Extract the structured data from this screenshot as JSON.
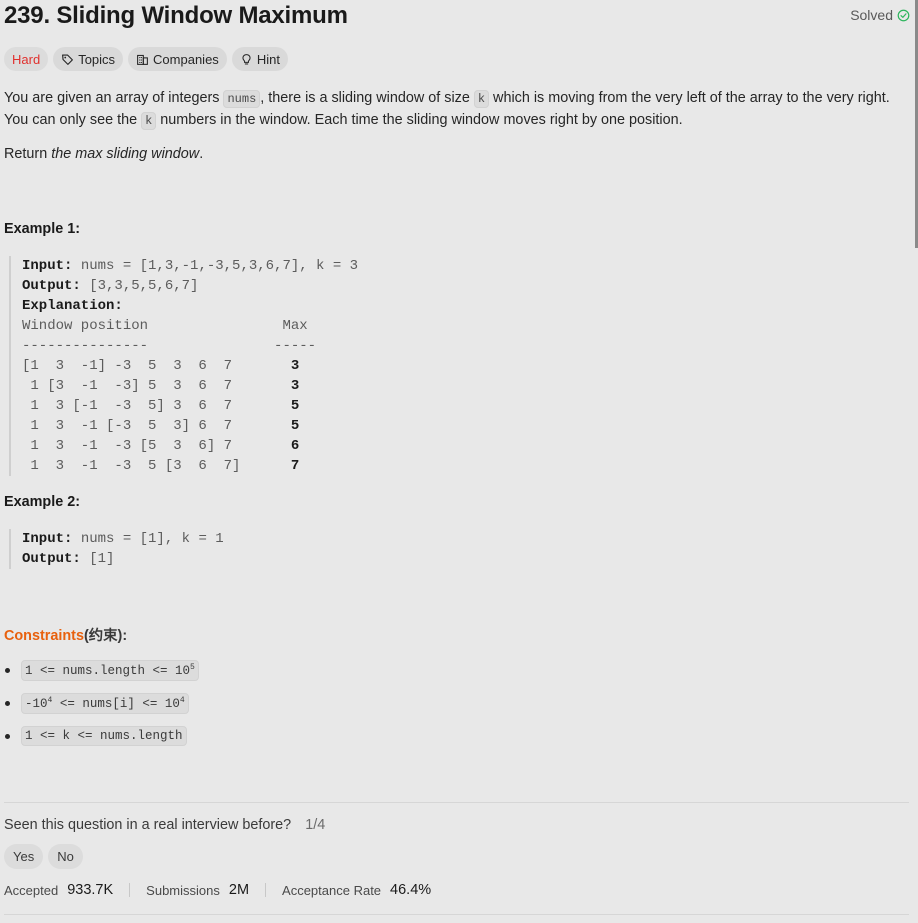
{
  "problem": {
    "number_title": "239. Sliding Window Maximum",
    "status": "Solved"
  },
  "tags": {
    "difficulty": "Hard",
    "topics": "Topics",
    "companies": "Companies",
    "hint": "Hint"
  },
  "description": {
    "p1_a": "You are given an array of integers ",
    "p1_code1": "nums",
    "p1_b": ", there is a sliding window of size ",
    "p1_code2": "k",
    "p1_c": " which is moving from the very left of the array to the very right. You can only see the ",
    "p1_code3": "k",
    "p1_d": " numbers in the window. Each time the sliding window moves right by one position.",
    "return_a": "Return ",
    "return_b": "the max sliding window",
    "return_c": "."
  },
  "example1": {
    "title": "Example 1:",
    "input_label": "Input:",
    "input_value": " nums = [1,3,-1,-3,5,3,6,7], k = 3",
    "output_label": "Output:",
    "output_value": " [3,3,5,5,6,7]",
    "explanation_label": "Explanation:",
    "header": "Window position                Max",
    "underline": "---------------               -----",
    "rows": [
      {
        "window": "[1  3  -1] -3  5  3  6  7",
        "max": "3"
      },
      {
        "window": " 1 [3  -1  -3] 5  3  6  7",
        "max": "3"
      },
      {
        "window": " 1  3 [-1  -3  5] 3  6  7",
        "max": "5"
      },
      {
        "window": " 1  3  -1 [-3  5  3] 6  7",
        "max": "5"
      },
      {
        "window": " 1  3  -1  -3 [5  3  6] 7",
        "max": "6"
      },
      {
        "window": " 1  3  -1  -3  5 [3  6  7]",
        "max": "7"
      }
    ]
  },
  "example2": {
    "title": "Example 2:",
    "input_label": "Input:",
    "input_value": " nums = [1], k = 1",
    "output_label": "Output:",
    "output_value": " [1]"
  },
  "constraints": {
    "title_orange": "Constraints",
    "title_rest": "(约束):",
    "c1_a": "1 <= nums.length <= 10",
    "c1_sup": "5",
    "c2_a": "-10",
    "c2_sup1": "4",
    "c2_b": " <= nums[i] <= 10",
    "c2_sup2": "4",
    "c3": "1 <= k <= nums.length"
  },
  "interview": {
    "question": "Seen this question in a real interview before?",
    "fraction": "1/4",
    "yes": "Yes",
    "no": "No"
  },
  "stats": {
    "accepted_label": "Accepted",
    "accepted_value": "933.7K",
    "submissions_label": "Submissions",
    "submissions_value": "2M",
    "rate_label": "Acceptance Rate",
    "rate_value": "46.4%"
  },
  "colors": {
    "hard": "#e0312e",
    "constraints_accent": "#e8610e",
    "solved_check": "#2db55d"
  }
}
